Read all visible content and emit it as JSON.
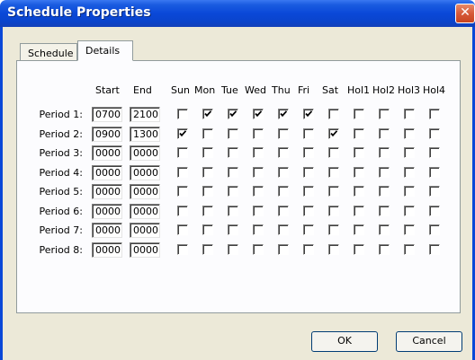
{
  "window": {
    "title": "Schedule Properties",
    "close_glyph": "✕"
  },
  "tabs": [
    {
      "label": "Schedule",
      "selected": false
    },
    {
      "label": "Details",
      "selected": true
    }
  ],
  "columns": {
    "start": "Start",
    "end": "End",
    "days": [
      "Sun",
      "Mon",
      "Tue",
      "Wed",
      "Thu",
      "Fri",
      "Sat",
      "Hol1",
      "Hol2",
      "Hol3",
      "Hol4"
    ]
  },
  "periods": [
    {
      "label": "Period 1:",
      "start": "0700",
      "end": "2100",
      "checks": [
        false,
        true,
        true,
        true,
        true,
        true,
        false,
        false,
        false,
        false,
        false
      ]
    },
    {
      "label": "Period 2:",
      "start": "0900",
      "end": "1300",
      "checks": [
        true,
        false,
        false,
        false,
        false,
        false,
        true,
        false,
        false,
        false,
        false
      ]
    },
    {
      "label": "Period 3:",
      "start": "0000",
      "end": "0000",
      "checks": [
        false,
        false,
        false,
        false,
        false,
        false,
        false,
        false,
        false,
        false,
        false
      ]
    },
    {
      "label": "Period 4:",
      "start": "0000",
      "end": "0000",
      "checks": [
        false,
        false,
        false,
        false,
        false,
        false,
        false,
        false,
        false,
        false,
        false
      ]
    },
    {
      "label": "Period 5:",
      "start": "0000",
      "end": "0000",
      "checks": [
        false,
        false,
        false,
        false,
        false,
        false,
        false,
        false,
        false,
        false,
        false
      ]
    },
    {
      "label": "Period 6:",
      "start": "0000",
      "end": "0000",
      "checks": [
        false,
        false,
        false,
        false,
        false,
        false,
        false,
        false,
        false,
        false,
        false
      ]
    },
    {
      "label": "Period 7:",
      "start": "0000",
      "end": "0000",
      "checks": [
        false,
        false,
        false,
        false,
        false,
        false,
        false,
        false,
        false,
        false,
        false
      ]
    },
    {
      "label": "Period 8:",
      "start": "0000",
      "end": "0000",
      "checks": [
        false,
        false,
        false,
        false,
        false,
        false,
        false,
        false,
        false,
        false,
        false
      ]
    }
  ],
  "buttons": {
    "ok": "OK",
    "cancel": "Cancel"
  },
  "colors": {
    "title_bar": "#0a48d8",
    "dialog_bg": "#ece9d8",
    "close_button": "#d65a3a"
  }
}
